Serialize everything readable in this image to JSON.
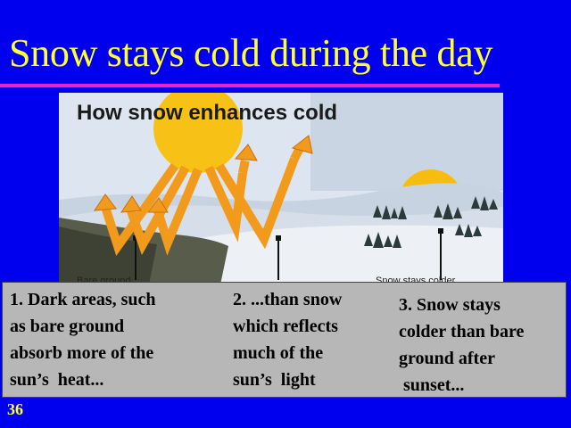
{
  "slide": {
    "title": "Snow stays cold during the day",
    "number": "36",
    "colors": {
      "background": "#0000ee",
      "title": "#ffff33",
      "underline": "#ee22cc",
      "caption_box": "#b7b7b7"
    }
  },
  "illustration": {
    "heading": "How snow enhances cold",
    "footer_labels": [
      "Bare ground",
      "Snow stays colder"
    ]
  },
  "captions": [
    "1. Dark areas, such\nas bare ground\nabsorb more of the\nsun’s  heat...",
    "2. ...than snow\nwhich reflects\nmuch of the\nsun’s  light",
    "3. Snow stays\ncolder than bare\nground after\n sunset..."
  ]
}
